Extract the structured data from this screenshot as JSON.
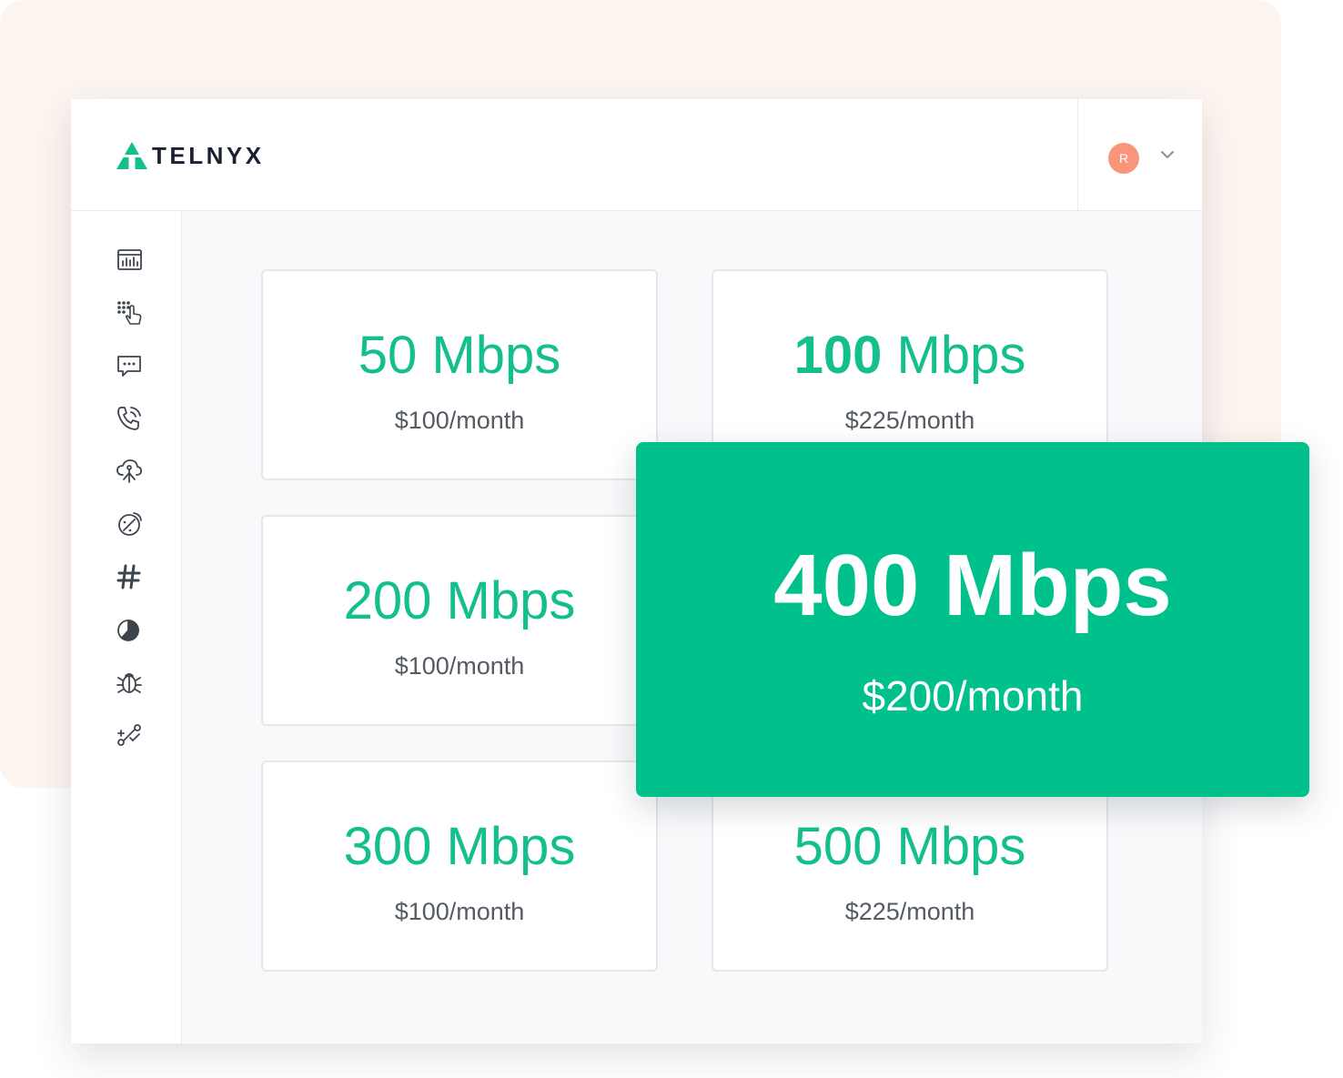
{
  "brand": {
    "name": "TELNYX",
    "accent": "#13bf8d"
  },
  "header": {
    "avatar_initial": "R",
    "avatar_color": "#f9967a",
    "menu_icon": "chevron-down-icon"
  },
  "sidebar": {
    "icons": [
      "dashboard-chart-icon",
      "keypad-touch-icon",
      "message-bubble-icon",
      "phone-call-icon",
      "cloud-network-icon",
      "satellite-icon",
      "hashtag-icon",
      "pie-chart-icon",
      "bug-debug-icon",
      "integrations-link-icon"
    ]
  },
  "plans": [
    {
      "speed_number": "50",
      "speed_unit": "Mbps",
      "price": "$100/month"
    },
    {
      "speed_number": "100",
      "speed_unit": "Mbps",
      "price": "$225/month"
    },
    {
      "speed_number": "200",
      "speed_unit": "Mbps",
      "price": "$100/month"
    },
    {
      "speed_number": "300",
      "speed_unit": "Mbps",
      "price": "$100/month"
    },
    {
      "speed_number": "500",
      "speed_unit": "Mbps",
      "price": "$225/month"
    }
  ],
  "featured": {
    "speed": "400 Mbps",
    "price": "$200/month",
    "color": "#00c08b"
  }
}
